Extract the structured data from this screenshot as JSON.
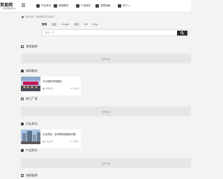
{
  "logo": {
    "main": "贸易网",
    "sub": "小易·贸易平台"
  },
  "nav": [
    {
      "label": "行业资讯",
      "icon": "news-icon"
    },
    {
      "label": "商网展览",
      "icon": "exhibition-icon"
    },
    {
      "label": "产品报价",
      "icon": "price-icon"
    },
    {
      "label": "选购指南",
      "icon": "guide-icon"
    },
    {
      "label": "关于",
      "icon": "about-icon"
    }
  ],
  "subbar": {
    "text": "您的位置：贸易网首页行业资讯"
  },
  "search": {
    "tabs": [
      "常用",
      "百度",
      "Google",
      "秘塔",
      "360",
      "Bing"
    ],
    "active_tab": "常用",
    "placeholder": "找找一下"
  },
  "sections": {
    "common": {
      "title": "常用推荐",
      "empty": "没有内容"
    },
    "exhibition": {
      "title": "商网展览"
    },
    "hot_factory": {
      "title": "热门厂家",
      "empty": "没有内容"
    },
    "industry": {
      "title": "行业资讯"
    },
    "product": {
      "title": "产品知识",
      "empty": "没有内容"
    },
    "guide": {
      "title": "选购链接"
    }
  },
  "cards": {
    "exhibition": {
      "title": "2024国际贸易展会",
      "category": "商网展览",
      "views": "67 次浏览"
    },
    "industry": {
      "title": "中企贸易：全球贸易新格局发展",
      "category": "行业资讯",
      "views": "67 次浏览"
    }
  }
}
